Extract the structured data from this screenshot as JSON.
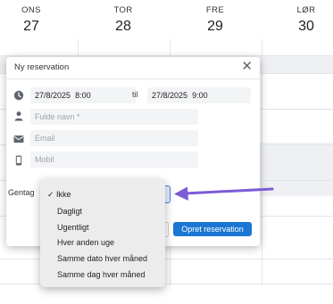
{
  "calendar": {
    "days": [
      {
        "dow": "ONS",
        "num": "27"
      },
      {
        "dow": "TOR",
        "num": "28"
      },
      {
        "dow": "FRE",
        "num": "29"
      },
      {
        "dow": "LØR",
        "num": "30"
      }
    ]
  },
  "dialog": {
    "title": "Ny reservation",
    "start_date": "27/8/2025",
    "start_time": "8:00",
    "til_label": "til",
    "end_date": "27/8/2025",
    "end_time": "9:00",
    "name_placeholder": "Fulde navn *",
    "email_placeholder": "Email",
    "mobile_placeholder": "Mobil",
    "repeat_label": "Gentag",
    "create_button": "Opret reservation",
    "icons": [
      "clock-icon",
      "person-icon",
      "mail-icon",
      "phone-icon",
      "close-icon"
    ]
  },
  "repeat_dropdown": {
    "selected": "Ikke",
    "options": [
      {
        "label": "Ikke",
        "checked": "✓"
      },
      {
        "label": "Dagligt",
        "checked": ""
      },
      {
        "label": "Ugentligt",
        "checked": ""
      },
      {
        "label": "Hver anden uge",
        "checked": ""
      },
      {
        "label": "Samme dato hver måned",
        "checked": ""
      },
      {
        "label": "Samme dag hver måned",
        "checked": ""
      }
    ]
  },
  "colors": {
    "primary_button": "#1976d2",
    "annotation_arrow": "#7c5cd6",
    "select_focus": "#3b82f6"
  }
}
